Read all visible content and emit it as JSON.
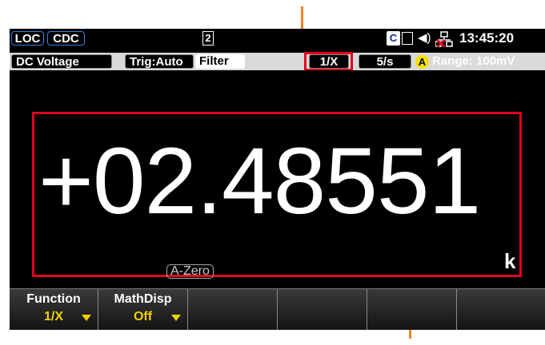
{
  "status": {
    "loc": "LOC",
    "cdc": "CDC",
    "page": "2",
    "ce": "C",
    "clock": "13:45:20"
  },
  "info": {
    "function": "DC Voltage",
    "trig": "Trig:Auto",
    "filter": "Filter",
    "math": "1/X",
    "rate": "5/s",
    "range_badge": "A",
    "range": "Range: 100mV"
  },
  "display": {
    "reading": "+02.48551",
    "unit": "k",
    "azero": "A-Zero"
  },
  "softkeys": [
    {
      "label": "Function",
      "value": "1/X"
    },
    {
      "label": "MathDisp",
      "value": "Off"
    },
    {
      "label": "",
      "value": ""
    },
    {
      "label": "",
      "value": ""
    },
    {
      "label": "",
      "value": ""
    },
    {
      "label": "",
      "value": ""
    }
  ],
  "colors": {
    "highlight": "#e1001e",
    "callout": "#f0821e",
    "softkey_value": "#f3d000"
  }
}
